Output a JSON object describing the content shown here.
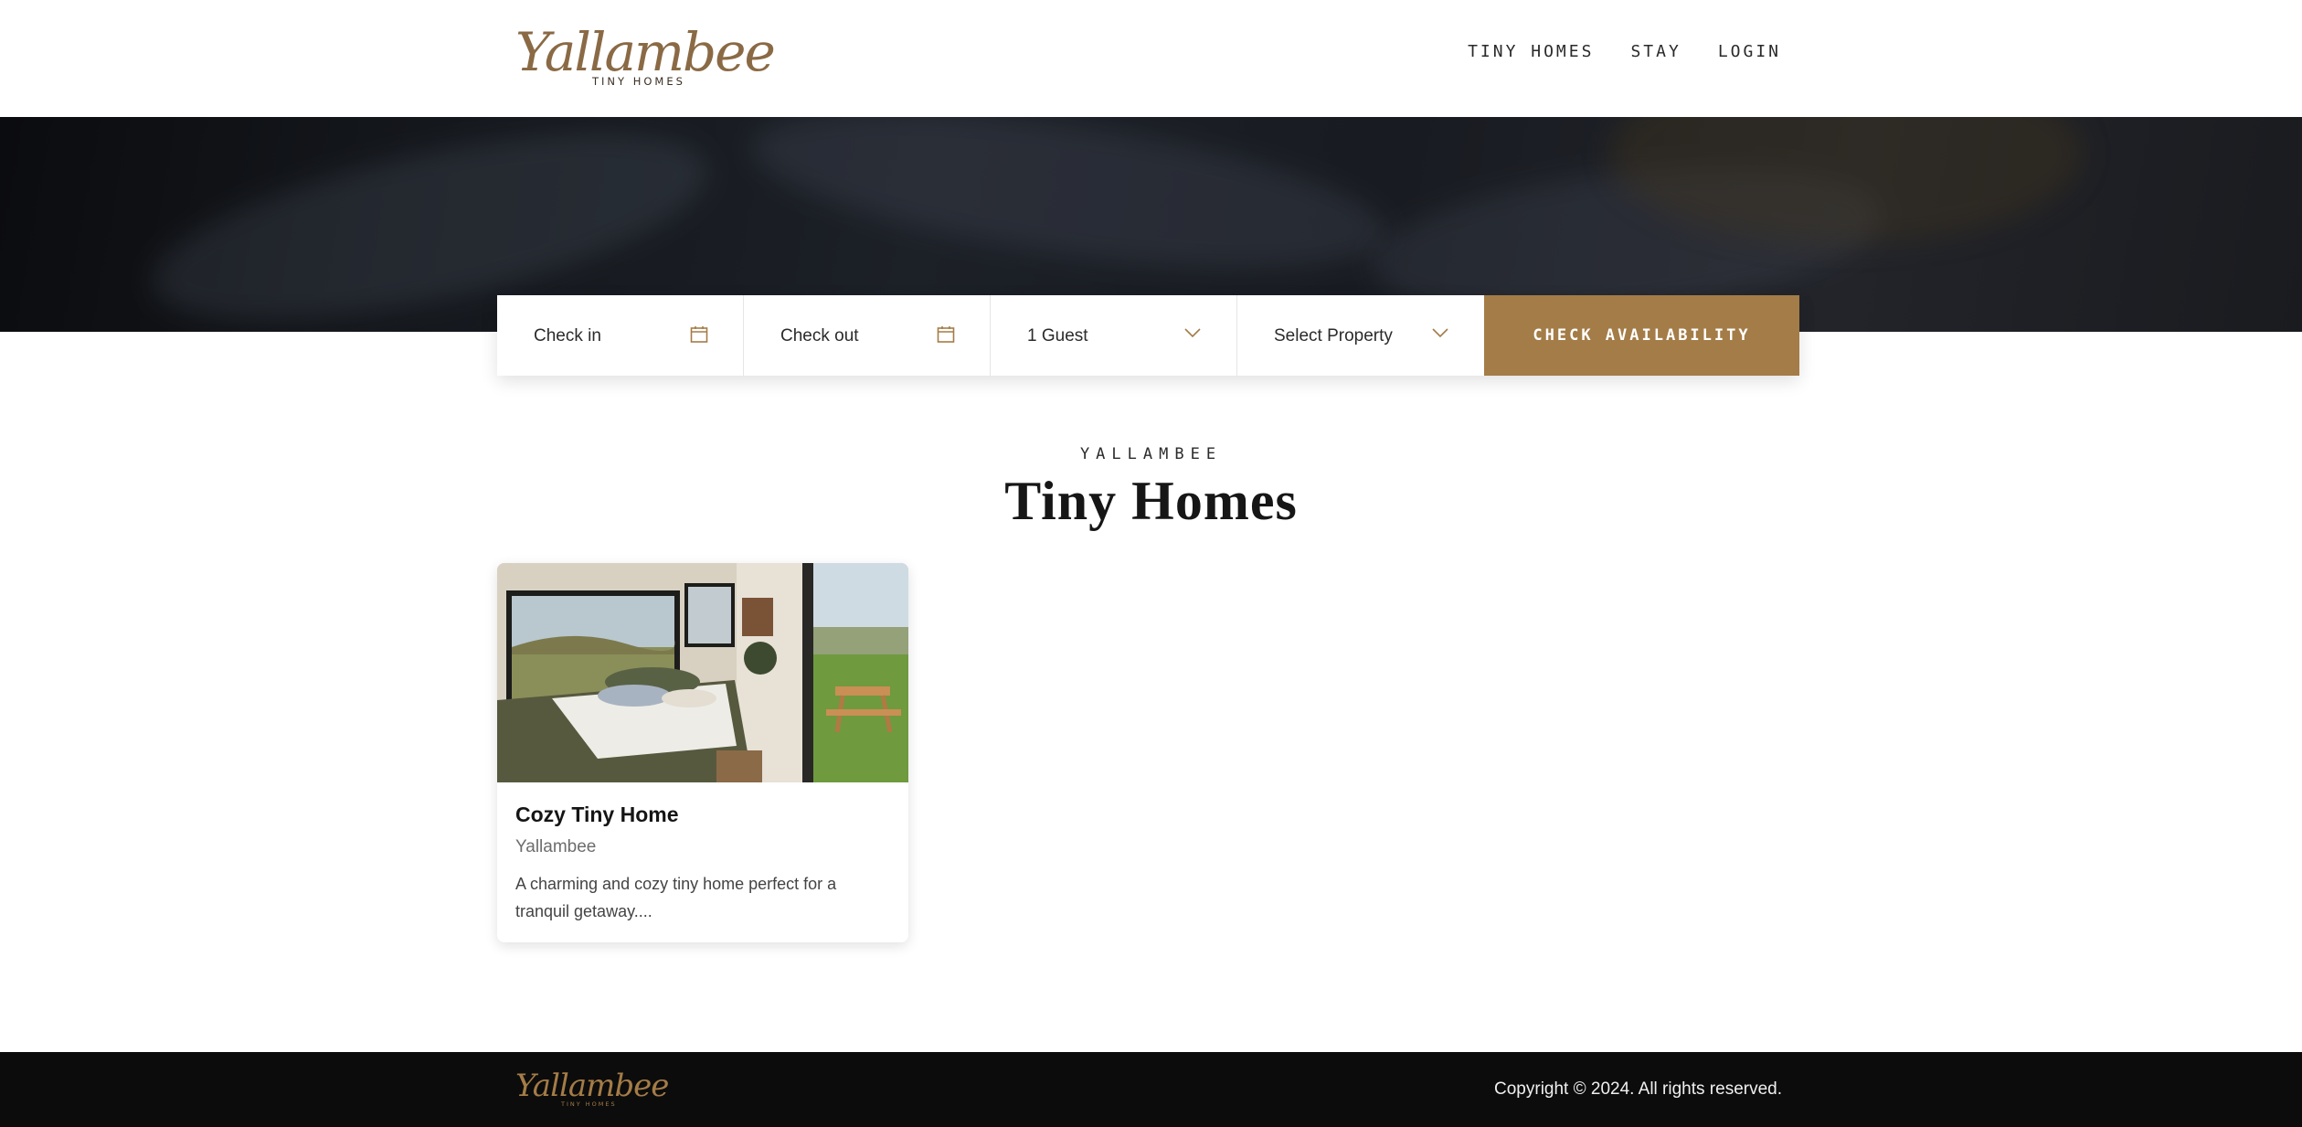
{
  "brand": {
    "name": "Yallambee",
    "tagline": "TINY HOMES"
  },
  "nav": {
    "items": [
      "TINY HOMES",
      "STAY",
      "LOGIN"
    ]
  },
  "booking": {
    "check_in": "Check in",
    "check_out": "Check out",
    "guests": "1 Guest",
    "property": "Select Property",
    "cta": "CHECK AVAILABILITY"
  },
  "section": {
    "eyebrow": "YALLAMBEE",
    "title": "Tiny Homes"
  },
  "cards": [
    {
      "title": "Cozy Tiny Home",
      "location": "Yallambee",
      "description": "A charming and cozy tiny home perfect for a tranquil getaway...."
    }
  ],
  "footer": {
    "copyright": "Copyright © 2024. All rights reserved."
  },
  "colors": {
    "accent": "#a47c47",
    "footer_bg": "#0c0c0c",
    "logo": "#8a6a45"
  },
  "icons": {
    "date": "calendar-icon",
    "dropdown": "chevron-down-icon"
  }
}
